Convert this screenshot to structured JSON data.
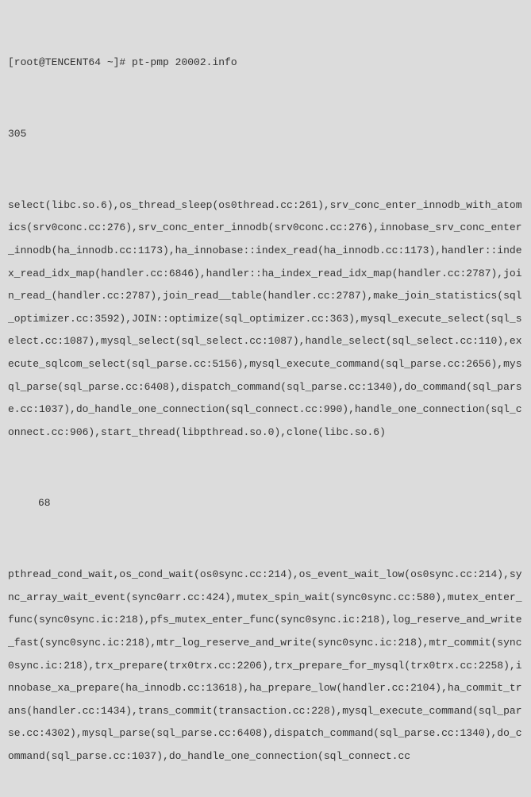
{
  "terminal": {
    "prompt": "[root@TENCENT64 ~]# ",
    "command": "pt-pmp 20002.info",
    "blocks": [
      {
        "count": "305",
        "indented": false,
        "trace": "select(libc.so.6),os_thread_sleep(os0thread.cc:261),srv_conc_enter_innodb_with_atomics(srv0conc.cc:276),srv_conc_enter_innodb(srv0conc.cc:276),innobase_srv_conc_enter_innodb(ha_innodb.cc:1173),ha_innobase::index_read(ha_innodb.cc:1173),handler::index_read_idx_map(handler.cc:6846),handler::ha_index_read_idx_map(handler.cc:2787),join_read_(handler.cc:2787),join_read__table(handler.cc:2787),make_join_statistics(sql_optimizer.cc:3592),JOIN::optimize(sql_optimizer.cc:363),mysql_execute_select(sql_select.cc:1087),mysql_select(sql_select.cc:1087),handle_select(sql_select.cc:110),execute_sqlcom_select(sql_parse.cc:5156),mysql_execute_command(sql_parse.cc:2656),mysql_parse(sql_parse.cc:6408),dispatch_command(sql_parse.cc:1340),do_command(sql_parse.cc:1037),do_handle_one_connection(sql_connect.cc:990),handle_one_connection(sql_connect.cc:906),start_thread(libpthread.so.0),clone(libc.so.6)"
      },
      {
        "count": "68",
        "indented": true,
        "trace": "pthread_cond_wait,os_cond_wait(os0sync.cc:214),os_event_wait_low(os0sync.cc:214),sync_array_wait_event(sync0arr.cc:424),mutex_spin_wait(sync0sync.cc:580),mutex_enter_func(sync0sync.ic:218),pfs_mutex_enter_func(sync0sync.ic:218),log_reserve_and_write_fast(sync0sync.ic:218),mtr_log_reserve_and_write(sync0sync.ic:218),mtr_commit(sync0sync.ic:218),trx_prepare(trx0trx.cc:2206),trx_prepare_for_mysql(trx0trx.cc:2258),innobase_xa_prepare(ha_innodb.cc:13618),ha_prepare_low(handler.cc:2104),ha_commit_trans(handler.cc:1434),trans_commit(transaction.cc:228),mysql_execute_command(sql_parse.cc:4302),mysql_parse(sql_parse.cc:6408),dispatch_command(sql_parse.cc:1340),do_command(sql_parse.cc:1037),do_handle_one_connection(sql_connect.cc"
      }
    ]
  }
}
